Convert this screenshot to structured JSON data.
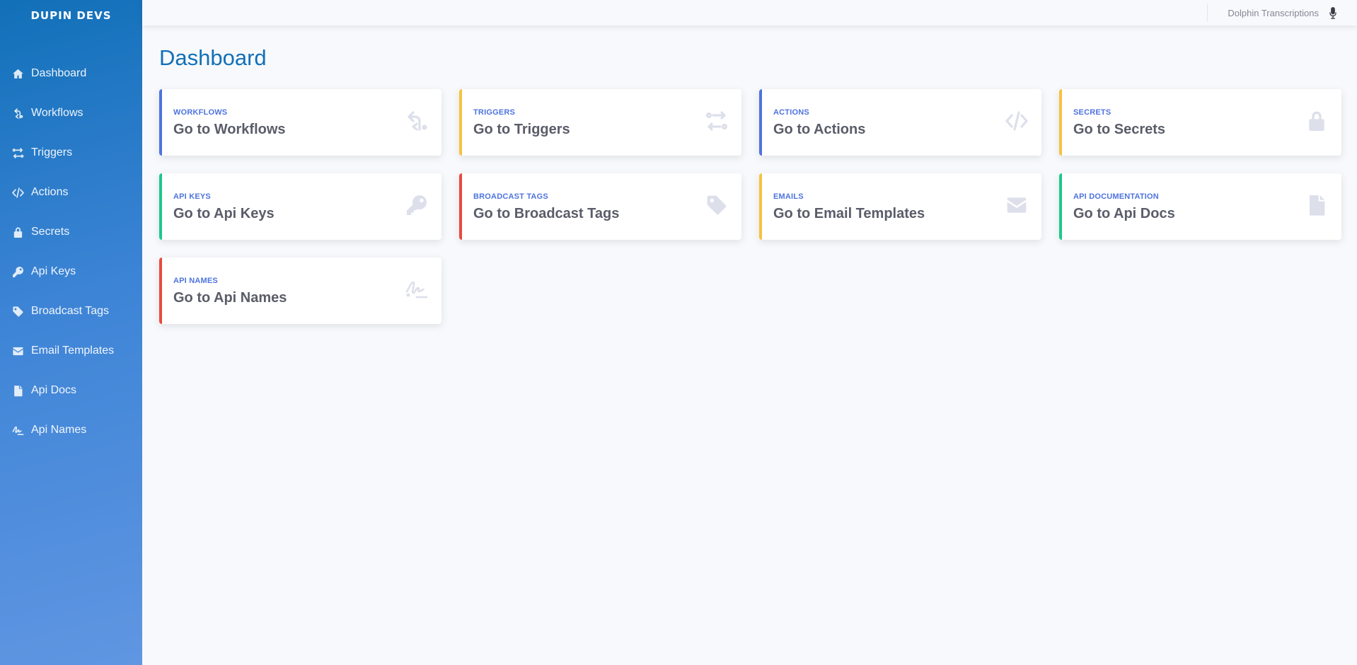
{
  "brand": {
    "name": "DUPIN DEVS"
  },
  "sidebar": {
    "items": [
      {
        "label": "Dashboard",
        "icon": "home-icon"
      },
      {
        "label": "Workflows",
        "icon": "workflow-icon"
      },
      {
        "label": "Triggers",
        "icon": "triggers-icon"
      },
      {
        "label": "Actions",
        "icon": "code-icon"
      },
      {
        "label": "Secrets",
        "icon": "lock-icon"
      },
      {
        "label": "Api Keys",
        "icon": "key-icon"
      },
      {
        "label": "Broadcast Tags",
        "icon": "tag-icon"
      },
      {
        "label": "Email Templates",
        "icon": "envelope-icon"
      },
      {
        "label": "Api Docs",
        "icon": "file-icon"
      },
      {
        "label": "Api Names",
        "icon": "signature-icon"
      }
    ]
  },
  "topbar": {
    "user_name": "Dolphin Transcriptions",
    "icon": "microphone-icon"
  },
  "main": {
    "title": "Dashboard",
    "cards": [
      {
        "label": "WORKFLOWS",
        "value": "Go to Workflows",
        "icon": "workflow-icon",
        "accent": "#4e73df"
      },
      {
        "label": "TRIGGERS",
        "value": "Go to Triggers",
        "icon": "triggers-icon",
        "accent": "#f6c23e"
      },
      {
        "label": "ACTIONS",
        "value": "Go to Actions",
        "icon": "code-icon",
        "accent": "#4e73df"
      },
      {
        "label": "SECRETS",
        "value": "Go to Secrets",
        "icon": "lock-icon",
        "accent": "#f6c23e"
      },
      {
        "label": "API KEYS",
        "value": "Go to Api Keys",
        "icon": "key-icon",
        "accent": "#1cc88a"
      },
      {
        "label": "BROADCAST TAGS",
        "value": "Go to Broadcast Tags",
        "icon": "tag-icon",
        "accent": "#e74a3b"
      },
      {
        "label": "EMAILS",
        "value": "Go to Email Templates",
        "icon": "envelope-icon",
        "accent": "#f6c23e"
      },
      {
        "label": "API DOCUMENTATION",
        "value": "Go to Api Docs",
        "icon": "file-icon",
        "accent": "#1cc88a"
      },
      {
        "label": "API NAMES",
        "value": "Go to Api Names",
        "icon": "signature-icon",
        "accent": "#e74a3b"
      }
    ]
  },
  "colors": {
    "sidebar_start": "#1170b8",
    "sidebar_end": "#6096e2",
    "title": "#1170b8",
    "card_label": "#4e73df",
    "card_value": "#5a5c69",
    "icon_muted": "#dddfeb"
  }
}
